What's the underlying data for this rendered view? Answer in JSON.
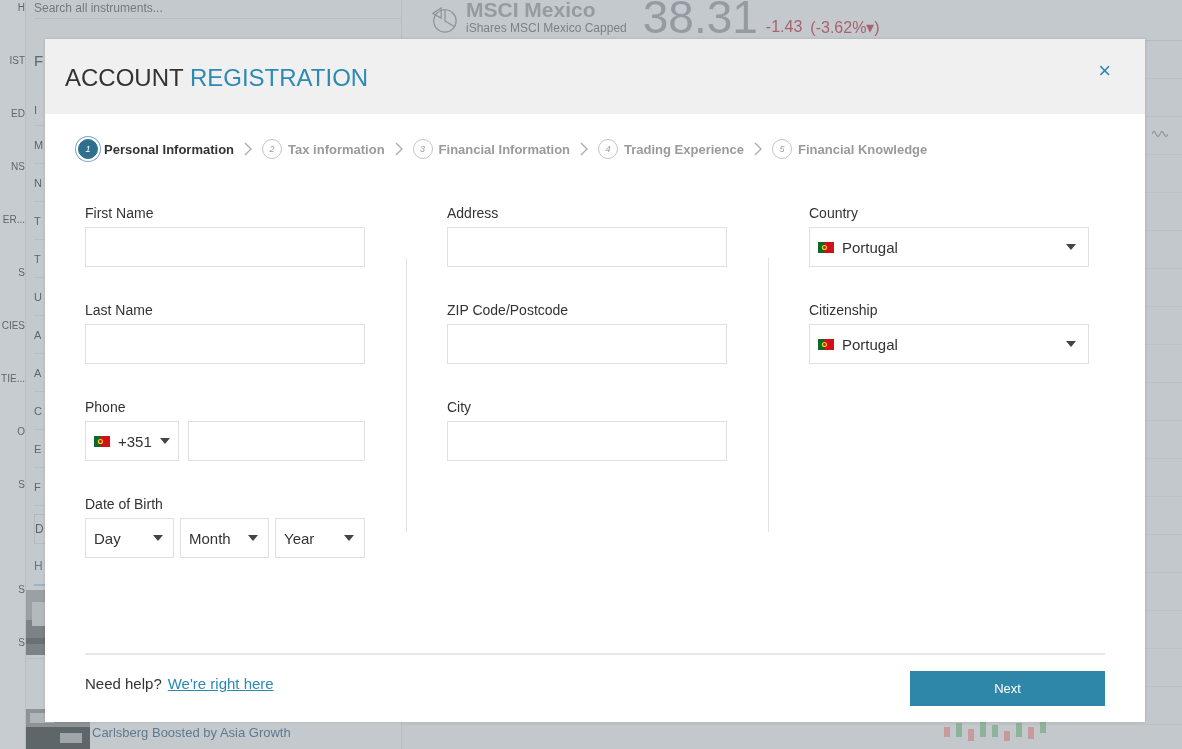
{
  "background": {
    "nav_items": [
      "H",
      "IST",
      "ED",
      "NS",
      "ER...",
      "S",
      "CIES",
      "TIE...",
      "O",
      "S",
      "S",
      "S"
    ],
    "search": {
      "placeholder": "Search all instruments..."
    },
    "panel_tab": "F",
    "list_items": [
      "I",
      "M",
      "N",
      "T",
      "T",
      "U",
      "A",
      "A",
      "C",
      "E",
      "F"
    ],
    "filter": "D",
    "news_tab": "H",
    "news_title": "Carlsberg Boosted by Asia Growth",
    "instrument": {
      "name": "MSCI Mexico",
      "subtitle": "iShares MSCI Mexico Capped",
      "price": "38.31",
      "change": "-1.43",
      "change_pct": "(-3.62%▾)"
    }
  },
  "dialog": {
    "title": "ACCOUNT",
    "title_accent": "REGISTRATION",
    "close": "×",
    "steps": [
      {
        "number": "1",
        "label": "Personal Information",
        "selected": true
      },
      {
        "number": "2",
        "label": "Tax information",
        "selected": false
      },
      {
        "number": "3",
        "label": "Financial Information",
        "selected": false
      },
      {
        "number": "4",
        "label": "Trading Experience",
        "selected": false
      },
      {
        "number": "5",
        "label": "Financial Knowledge",
        "selected": false
      }
    ],
    "columns": [
      [
        {
          "kind": "text",
          "label": "First Name"
        },
        {
          "kind": "text",
          "label": "Last Name"
        },
        {
          "kind": "phone",
          "label": "Phone",
          "code": "+351"
        },
        {
          "kind": "date",
          "label": "Date of Birth",
          "parts": [
            "Day",
            "Month",
            "Year"
          ]
        }
      ],
      [
        {
          "kind": "text",
          "label": "Address"
        },
        {
          "kind": "text",
          "label": "ZIP Code/Postcode"
        },
        {
          "kind": "text",
          "label": "City"
        }
      ],
      [
        {
          "kind": "select",
          "label": "Country",
          "value": "Portugal"
        },
        {
          "kind": "select",
          "label": "Citizenship",
          "value": "Portugal"
        }
      ]
    ],
    "help": "Need help?",
    "help_link": "We're right here",
    "next": "Next"
  }
}
